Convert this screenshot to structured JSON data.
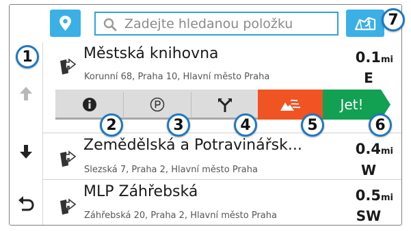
{
  "search": {
    "placeholder": "Zadejte hledanou položku"
  },
  "results": [
    {
      "name": "Městská knihovna",
      "address": "Korunní 68, Praha 10, Hlavní město Praha",
      "distance": "0.1",
      "unit": "mi",
      "direction": "E"
    },
    {
      "name": "Zemědělská a Potravinářsk...",
      "address": "Slezská 7, Praha 2, Hlavní město Praha",
      "distance": "0.4",
      "unit": "mi",
      "direction": "W"
    },
    {
      "name": "MLP Záhřebská",
      "address": "Záhřebská 20, Praha 2, Hlavní město Praha",
      "distance": "0.5",
      "unit": "mi",
      "direction": "SW"
    }
  ],
  "actions": {
    "go_label": "Jet!"
  },
  "callouts": [
    "1",
    "2",
    "3",
    "4",
    "5",
    "6",
    "7"
  ],
  "colors": {
    "accent_blue": "#3ab0e6",
    "callout_border": "#1f78c1",
    "go_green": "#12a053",
    "trail_orange": "#f05423"
  },
  "icons": {
    "top_left": "location-pin-icon",
    "search": "search-icon",
    "top_right": "map-view-icon",
    "rail_up": "arrow-up-icon",
    "rail_down": "arrow-down-icon",
    "rail_back": "back-icon",
    "poi": "navigate-arrow-icon",
    "info": "info-icon",
    "parking": "parking-icon",
    "route": "route-fork-icon",
    "trail": "trail-icon"
  }
}
